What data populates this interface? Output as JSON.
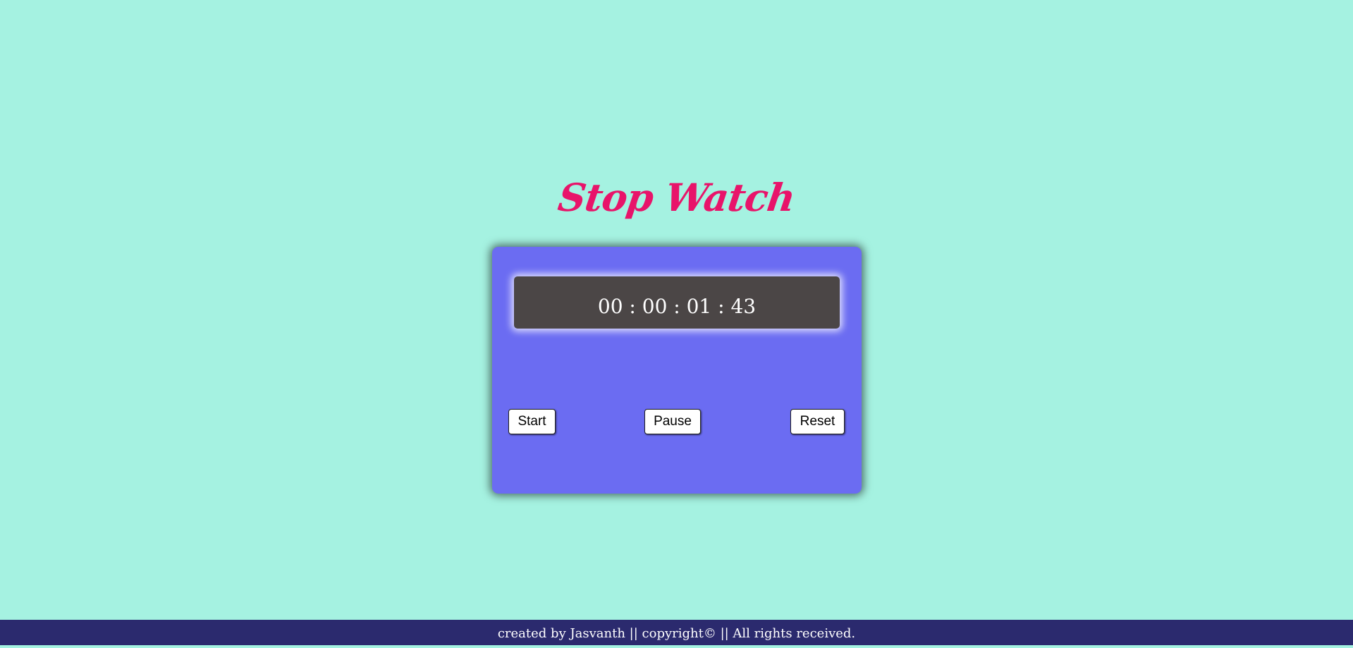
{
  "page": {
    "background_color": "#a5f2e1"
  },
  "header": {
    "title": "Stop Watch",
    "title_color": "#e8146a"
  },
  "stopwatch": {
    "card_color": "#6b6cf2",
    "display_color": "#4b4646",
    "display_text": "00 : 00 : 01 : 43",
    "buttons": {
      "start_label": "Start",
      "pause_label": "Pause",
      "reset_label": "Reset"
    }
  },
  "footer": {
    "text": "created by Jasvanth || copyright© || All rights received.",
    "background_color": "#2b2a6e"
  }
}
